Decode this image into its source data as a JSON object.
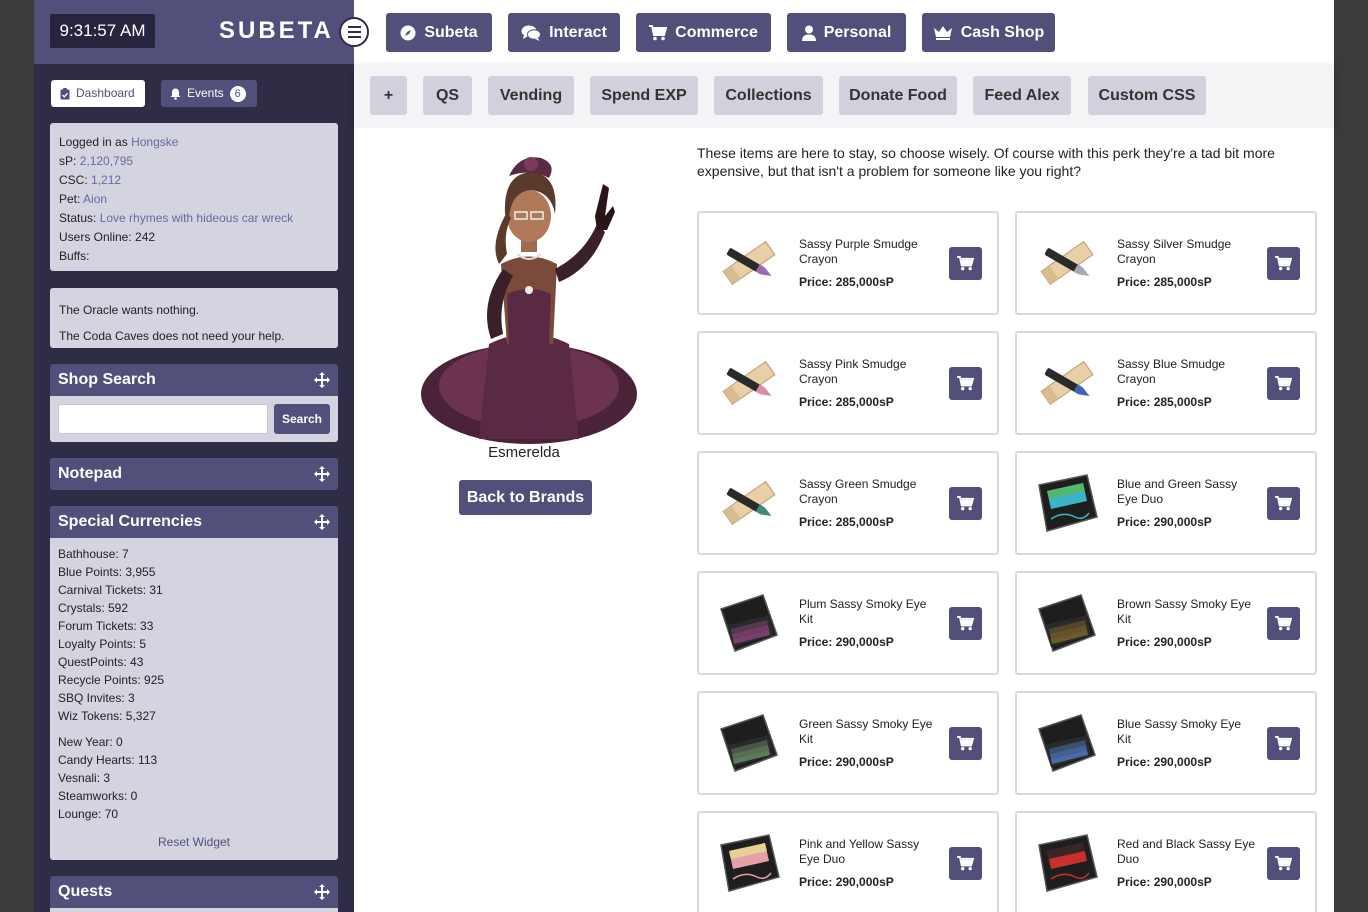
{
  "clock": "9:31:57 AM",
  "logo": "SUBETA",
  "sidebar": {
    "dashboard_label": "Dashboard",
    "events_label": "Events",
    "events_count": "6",
    "user": {
      "logged_in_prefix": "Logged in as",
      "username": "Hongske",
      "sp_label": "sP:",
      "sp_value": "2,120,795",
      "csc_label": "CSC:",
      "csc_value": "1,212",
      "pet_label": "Pet:",
      "pet_value": "Aion",
      "status_label": "Status:",
      "status_value": "Love rhymes with hideous car wreck",
      "users_online": "Users Online: 242",
      "buffs": "Buffs:"
    },
    "oracle": "The Oracle wants nothing.",
    "coda": "The Coda Caves does not need your help.",
    "shop_search": {
      "title": "Shop Search",
      "button": "Search",
      "value": "",
      "placeholder": ""
    },
    "notepad_title": "Notepad",
    "currencies": {
      "title": "Special Currencies",
      "group1": [
        "Bathhouse: 7",
        "Blue Points: 3,955",
        "Carnival Tickets: 31",
        "Crystals: 592",
        "Forum Tickets: 33",
        "Loyalty Points: 5",
        "QuestPoints: 43",
        "Recycle Points: 925",
        "SBQ Invites: 3",
        "Wiz Tokens: 5,327"
      ],
      "group2": [
        "New Year: 0",
        "Candy Hearts: 113",
        "Vesnali: 3",
        "Steamworks: 0",
        "Lounge: 70"
      ],
      "reset": "Reset Widget"
    },
    "quests_title": "Quests"
  },
  "topnav": [
    "Subeta",
    "Interact",
    "Commerce",
    "Personal",
    "Cash Shop"
  ],
  "subnav": [
    "+",
    "QS",
    "Vending",
    "Spend EXP",
    "Collections",
    "Donate Food",
    "Feed Alex",
    "Custom CSS"
  ],
  "npc": {
    "name": "Esmerelda",
    "back_button": "Back to Brands"
  },
  "intro": "These items are here to stay, so choose wisely. Of course with this perk they're a tad bit more expensive, but that isn't a problem for someone like you right?",
  "price_label": "Price:",
  "items": [
    {
      "name": "Sassy Purple Smudge Crayon",
      "price": "285,000sP",
      "kind": "crayon",
      "color": "#9b6bb0"
    },
    {
      "name": "Sassy Silver Smudge Crayon",
      "price": "285,000sP",
      "kind": "crayon",
      "color": "#a9a9b4"
    },
    {
      "name": "Sassy Pink Smudge Crayon",
      "price": "285,000sP",
      "kind": "crayon",
      "color": "#d98fa3"
    },
    {
      "name": "Sassy Blue Smudge Crayon",
      "price": "285,000sP",
      "kind": "crayon",
      "color": "#3e64b8"
    },
    {
      "name": "Sassy Green Smudge Crayon",
      "price": "285,000sP",
      "kind": "crayon",
      "color": "#3d8a78"
    },
    {
      "name": "Blue and Green Sassy Eye Duo",
      "price": "290,000sP",
      "kind": "duo",
      "color": "#3ab4c8",
      "color2": "#56b85e"
    },
    {
      "name": "Plum Sassy Smoky Eye Kit",
      "price": "290,000sP",
      "kind": "kit",
      "color": "#7a3f6e"
    },
    {
      "name": "Brown Sassy Smoky Eye Kit",
      "price": "290,000sP",
      "kind": "kit",
      "color": "#6f5a2c"
    },
    {
      "name": "Green Sassy Smoky Eye Kit",
      "price": "290,000sP",
      "kind": "kit",
      "color": "#5f7a5a"
    },
    {
      "name": "Blue Sassy Smoky Eye Kit",
      "price": "290,000sP",
      "kind": "kit",
      "color": "#4a6aa8"
    },
    {
      "name": "Pink and Yellow Sassy Eye Duo",
      "price": "290,000sP",
      "kind": "duo",
      "color": "#e8a0a8",
      "color2": "#e8d890"
    },
    {
      "name": "Red and Black Sassy Eye Duo",
      "price": "290,000sP",
      "kind": "duo",
      "color": "#c8302c",
      "color2": "#222222"
    }
  ],
  "colors": {
    "accent": "#52507a",
    "sidebar": "#2f2d45",
    "panel": "#d4d3e0"
  }
}
